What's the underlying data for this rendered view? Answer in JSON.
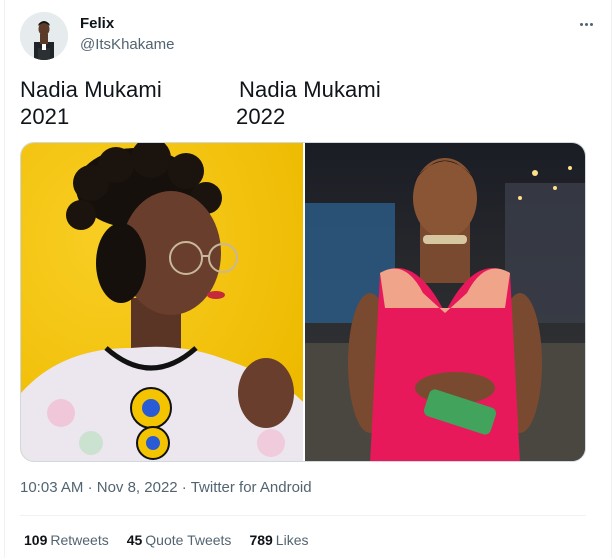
{
  "author": {
    "display_name": "Felix",
    "handle": "@ItsKhakame"
  },
  "tweet": {
    "left_column": {
      "line1": "Nadia Mukami",
      "line2": "2021"
    },
    "right_column": {
      "line1": "Nadia Mukami",
      "line2": "2022"
    }
  },
  "meta": {
    "time": "10:03 AM",
    "separator": "·",
    "date": "Nov 8, 2022",
    "source": "Twitter for Android"
  },
  "stats": [
    {
      "count": "109",
      "label": "Retweets"
    },
    {
      "count": "45",
      "label": "Quote Tweets"
    },
    {
      "count": "789",
      "label": "Likes"
    }
  ],
  "icons": {
    "more": "more-horizontal-icon",
    "avatar": "avatar"
  },
  "colors": {
    "text_primary": "#0f1419",
    "text_secondary": "#536471",
    "border": "#cfd9de",
    "photo1_bg": "#f5c400",
    "photo2_dress": "#e8195a"
  }
}
